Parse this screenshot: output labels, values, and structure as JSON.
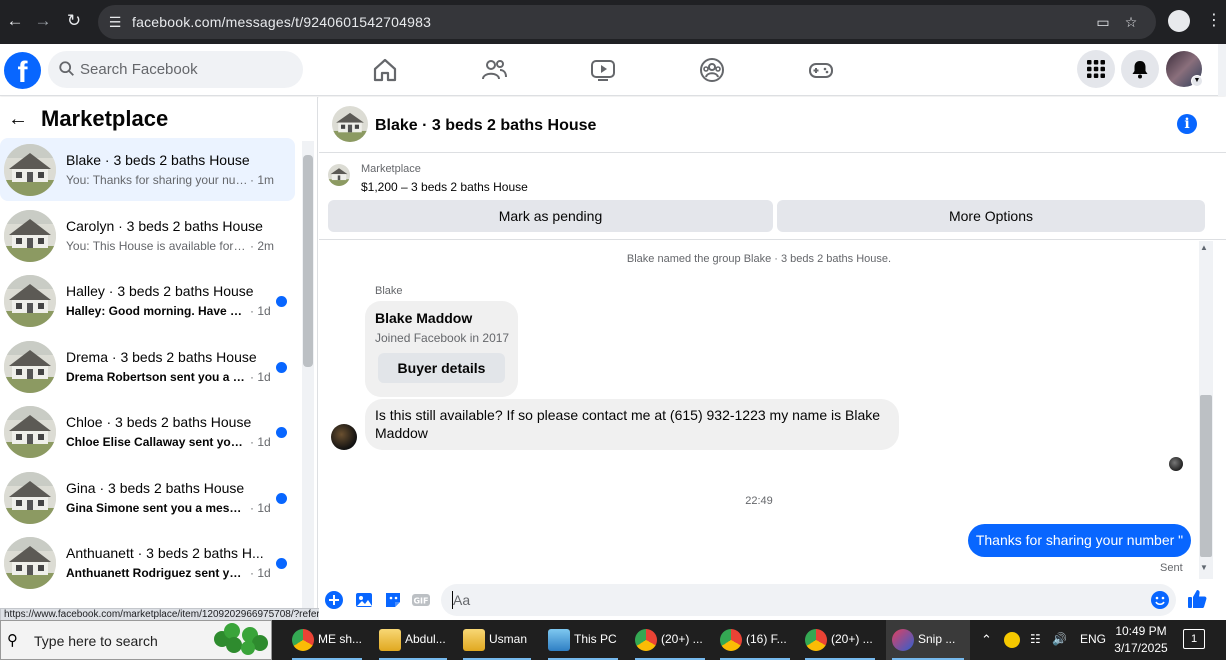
{
  "browser": {
    "url": "facebook.com/messages/t/9240601542704983",
    "status_url": "https://www.facebook.com/marketplace/item/1209202966975708/?referralSurface..."
  },
  "fb": {
    "search_placeholder": "Search Facebook",
    "logo_letter": "f"
  },
  "left_panel": {
    "title": "Marketplace",
    "conversations": [
      {
        "name": "Blake · 3 beds 2 baths House",
        "snippet": "You: Thanks for sharing your num...",
        "time": "· 1m",
        "unread": false,
        "active": true
      },
      {
        "name": "Carolyn · 3 beds 2 baths House",
        "snippet": "You: This House is available for ren...",
        "time": "· 2m",
        "unread": false,
        "active": false
      },
      {
        "name": "Halley · 3 beds 2 baths House",
        "snippet": "Halley: Good morning. Have we...",
        "time": "· 1d",
        "unread": true,
        "active": false
      },
      {
        "name": "Drema · 3 beds 2 baths House",
        "snippet": "Drema Robertson sent you a m...",
        "time": "· 1d",
        "unread": true,
        "active": false
      },
      {
        "name": "Chloe · 3 beds 2 baths House",
        "snippet": "Chloe Elise Callaway sent you a ...",
        "time": "· 1d",
        "unread": true,
        "active": false
      },
      {
        "name": "Gina · 3 beds 2 baths House",
        "snippet": "Gina Simone sent you a messag...",
        "time": "· 1d",
        "unread": true,
        "active": false
      },
      {
        "name": "Anthuanett · 3 beds 2 baths H...",
        "snippet": "Anthuanett Rodriguez sent you ...",
        "time": "· 1d",
        "unread": true,
        "active": false
      }
    ]
  },
  "chat": {
    "title": "Blake · 3 beds 2 baths House",
    "info_glyph": "i",
    "marketplace_label": "Marketplace",
    "listing": "$1,200 – 3 beds 2 baths House",
    "buttons": {
      "pending": "Mark as pending",
      "more": "More Options"
    },
    "system_message": "Blake named the group Blake · 3 beds 2 baths House.",
    "sender_label": "Blake",
    "card": {
      "name": "Blake Maddow",
      "sub": "Joined Facebook in 2017",
      "button": "Buyer details"
    },
    "incoming_message": "Is this still available? If so please contact me at (615) 932-1223 my name is Blake Maddow",
    "timestamp": "22:49",
    "outgoing_message": "Thanks for sharing your number \"",
    "sent_label": "Sent",
    "composer_placeholder": "Aa"
  },
  "taskbar": {
    "search_text": "Type here to search",
    "apps": [
      {
        "label": "ME sh...",
        "icon": "chrome-icon"
      },
      {
        "label": "Abdul...",
        "icon": "folder-icon"
      },
      {
        "label": "Usman",
        "icon": "folder-icon"
      },
      {
        "label": "This PC",
        "icon": "this-pc-icon"
      },
      {
        "label": "(20+) ...",
        "icon": "chrome-icon"
      },
      {
        "label": "(16) F...",
        "icon": "chrome-icon"
      },
      {
        "label": "(20+) ...",
        "icon": "chrome-icon"
      },
      {
        "label": "Snip ...",
        "icon": "snip-icon"
      }
    ],
    "lang": "ENG",
    "time": "10:49 PM",
    "date": "3/17/2025",
    "notifications": "1"
  },
  "colors": {
    "accent": "#0866ff",
    "chrome_bg": "#202124",
    "taskbar_bg": "#1f1f1f"
  }
}
